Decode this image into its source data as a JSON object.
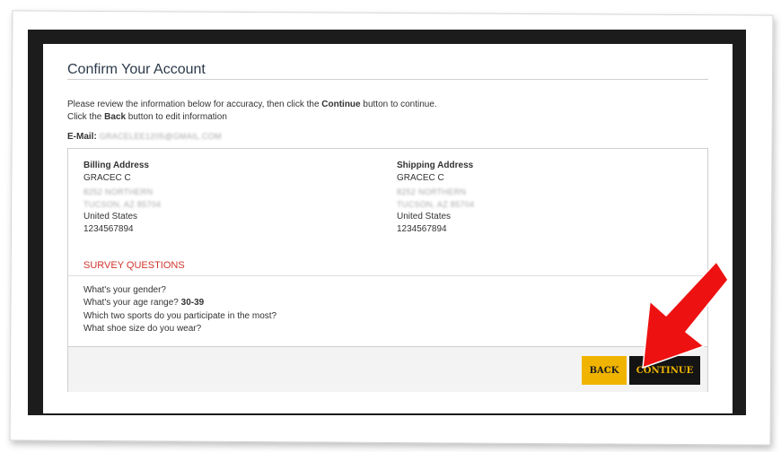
{
  "page": {
    "title": "Confirm Your Account",
    "intro_line1_pre": "Please review the information below for accuracy, then click the ",
    "intro_line1_bold": "Continue",
    "intro_line1_post": " button to continue.",
    "intro_line2_pre": "Click the ",
    "intro_line2_bold": "Back",
    "intro_line2_post": " button to edit information"
  },
  "email": {
    "label": "E-Mail:",
    "value": "GRACELEE1205@GMAIL.COM"
  },
  "billing": {
    "heading": "Billing Address",
    "name": "GRACEC C",
    "street": "8252 NORTHERN",
    "city": "TUCSON, AZ 85704",
    "country": "United States",
    "phone": "1234567894"
  },
  "shipping": {
    "heading": "Shipping Address",
    "name": "GRACEC C",
    "street": "8252 NORTHERN",
    "city": "TUCSON, AZ 85704",
    "country": "United States",
    "phone": "1234567894"
  },
  "survey": {
    "title": "SURVEY QUESTIONS",
    "q1": "What's your gender?",
    "q2": "What's your age range?",
    "q2_answer": "30-39",
    "q3": "Which two sports do you participate in the most?",
    "q4": "What shoe size do you wear?"
  },
  "buttons": {
    "back": "BACK",
    "continue": "CONTINUE"
  },
  "colors": {
    "accent_yellow": "#f0b400",
    "survey_red": "#d0342c",
    "arrow_red": "#ee1111"
  },
  "icons": {
    "annotation": "red-arrow-icon"
  }
}
